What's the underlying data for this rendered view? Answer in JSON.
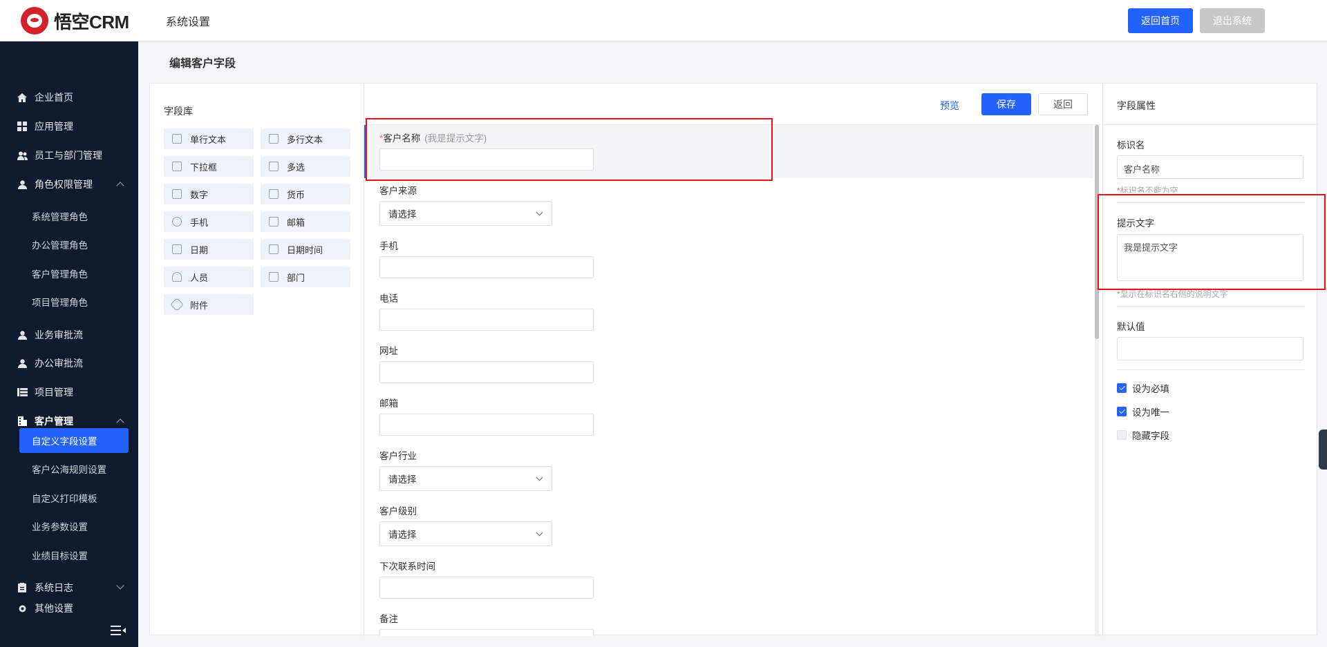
{
  "header": {
    "logo_text": "悟空CRM",
    "module_title": "系统设置",
    "btn_home": "返回首页",
    "btn_exit": "退出系统"
  },
  "sidebar": {
    "items": [
      {
        "label": "企业首页",
        "icon": "home-icon"
      },
      {
        "label": "应用管理",
        "icon": "grid-icon"
      },
      {
        "label": "员工与部门管理",
        "icon": "users-icon"
      },
      {
        "label": "角色权限管理",
        "icon": "user-icon"
      },
      {
        "label": "系统管理角色"
      },
      {
        "label": "办公管理角色"
      },
      {
        "label": "客户管理角色"
      },
      {
        "label": "项目管理角色"
      },
      {
        "label": "业务审批流",
        "icon": "user-icon"
      },
      {
        "label": "办公审批流",
        "icon": "user-icon"
      },
      {
        "label": "项目管理",
        "icon": "list-icon"
      },
      {
        "label": "客户管理",
        "icon": "building-icon"
      },
      {
        "label": "自定义字段设置"
      },
      {
        "label": "客户公海规则设置"
      },
      {
        "label": "自定义打印模板"
      },
      {
        "label": "业务参数设置"
      },
      {
        "label": "业绩目标设置"
      },
      {
        "label": "系统日志",
        "icon": "clipboard-icon"
      },
      {
        "label": "其他设置",
        "icon": "gear-icon"
      }
    ]
  },
  "page_title": "编辑客户字段",
  "library": {
    "title": "字段库",
    "fields": [
      "单行文本",
      "多行文本",
      "下拉框",
      "多选",
      "数字",
      "货币",
      "手机",
      "邮箱",
      "日期",
      "日期时间",
      "人员",
      "部门",
      "附件"
    ]
  },
  "toolbar": {
    "preview": "预览",
    "save": "保存",
    "back": "返回"
  },
  "form": {
    "selected_label": "客户名称",
    "selected_hint": "(我是提示文字)",
    "select_placeholder": "请选择",
    "fields": [
      "客户来源",
      "手机",
      "电话",
      "网址",
      "邮箱",
      "客户行业",
      "客户级别",
      "下次联系时间",
      "备注"
    ]
  },
  "props": {
    "title": "字段属性",
    "name_label": "标识名",
    "name_value": "客户名称",
    "name_note": "标识名不能为空",
    "hint_label": "提示文字",
    "hint_value": "我是提示文字",
    "hint_note": "显示在标识名右侧的说明文字",
    "default_label": "默认值",
    "cb_required": "设为必填",
    "cb_unique": "设为唯一",
    "cb_hidden": "隐藏字段"
  }
}
